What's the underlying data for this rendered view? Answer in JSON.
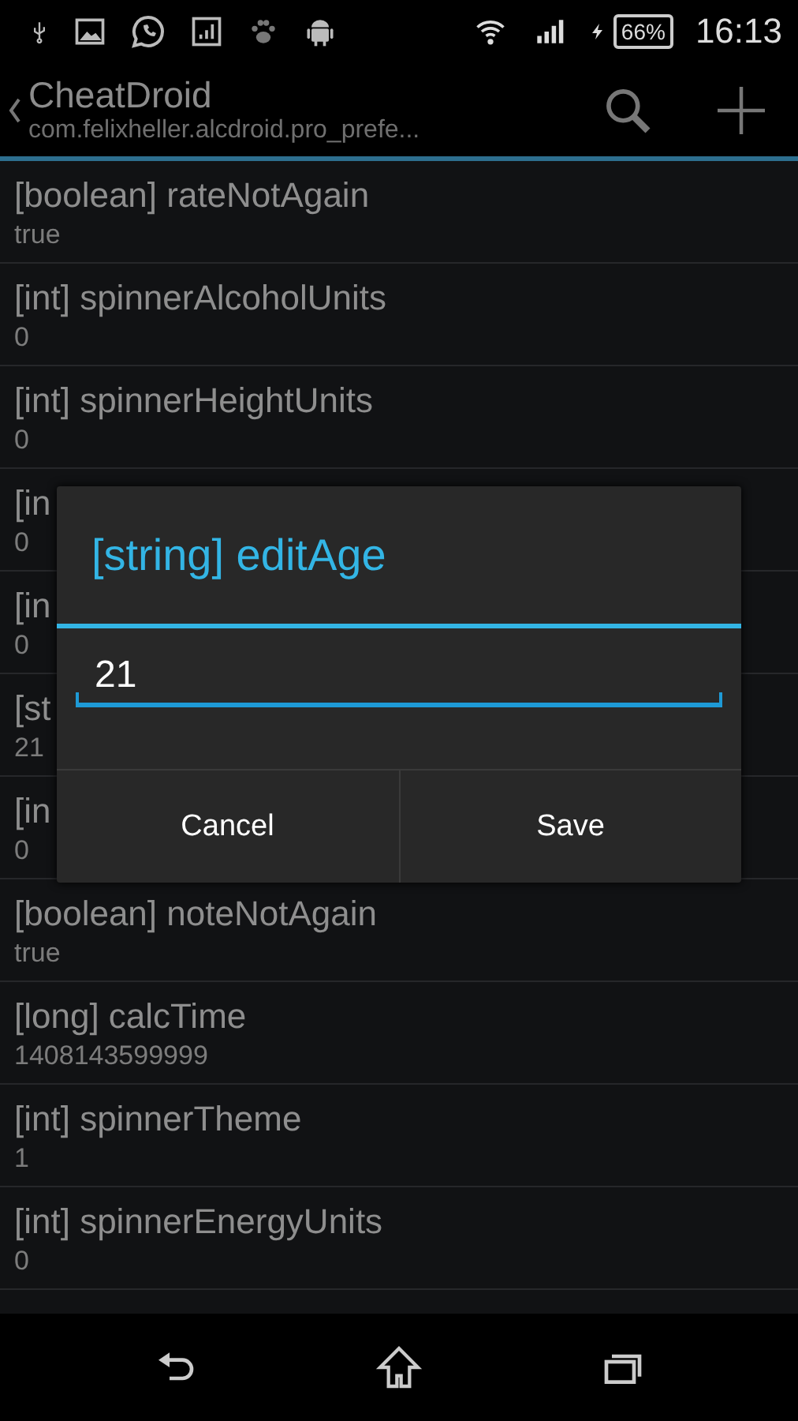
{
  "status_bar": {
    "battery": "66%",
    "time": "16:13"
  },
  "action_bar": {
    "title": "CheatDroid",
    "subtitle": "com.felixheller.alcdroid.pro_prefe..."
  },
  "preferences": [
    {
      "name": "[boolean] rateNotAgain",
      "value": "true"
    },
    {
      "name": "[int] spinnerAlcoholUnits",
      "value": "0"
    },
    {
      "name": "[int] spinnerHeightUnits",
      "value": "0"
    },
    {
      "name": "[in",
      "value": "0"
    },
    {
      "name": "[in",
      "value": "0"
    },
    {
      "name": "[st",
      "value": "21"
    },
    {
      "name": "[in",
      "value": "0"
    },
    {
      "name": "[boolean] noteNotAgain",
      "value": "true"
    },
    {
      "name": "[long] calcTime",
      "value": "1408143599999"
    },
    {
      "name": "[int] spinnerTheme",
      "value": "1"
    },
    {
      "name": "[int] spinnerEnergyUnits",
      "value": "0"
    }
  ],
  "dialog": {
    "title": "[string] editAge",
    "value": "21",
    "buttons": [
      "Cancel",
      "Save"
    ]
  }
}
